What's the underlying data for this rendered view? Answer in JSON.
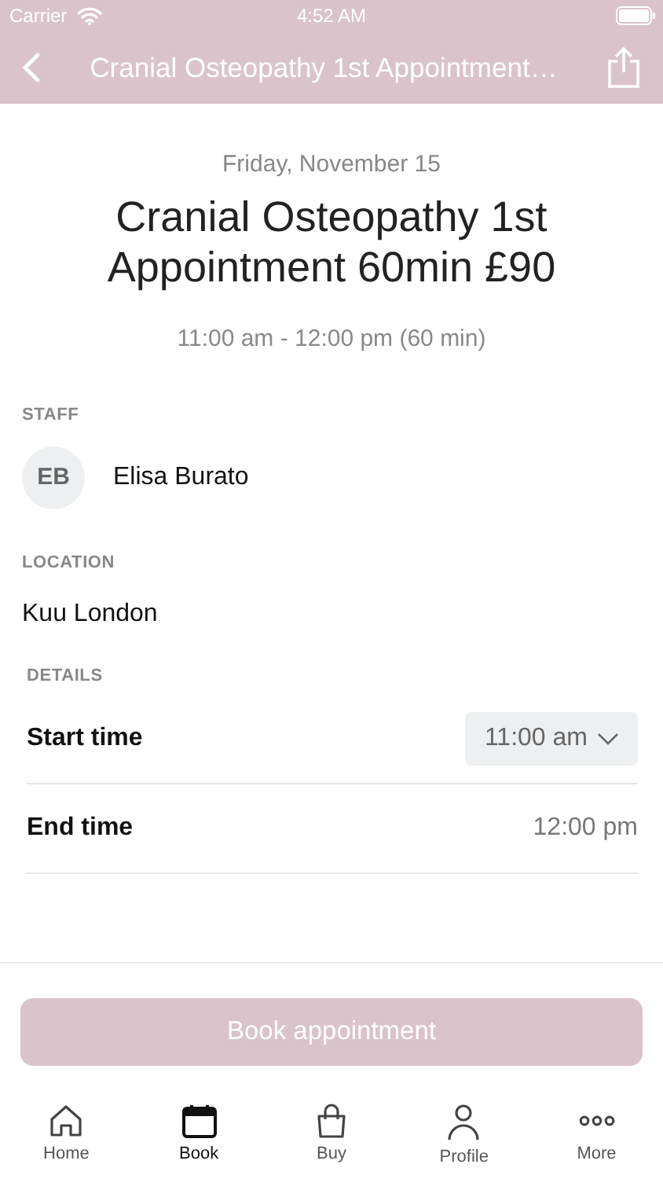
{
  "status_bar": {
    "carrier": "Carrier",
    "time": "4:52 AM"
  },
  "nav": {
    "title": "Cranial Osteopathy 1st Appointment…"
  },
  "header": {
    "date": "Friday, November 15",
    "title": "Cranial Osteopathy 1st Appointment 60min £90",
    "time_range": "11:00 am - 12:00 pm (60 min)"
  },
  "staff": {
    "heading": "STAFF",
    "initials": "EB",
    "name": "Elisa Burato"
  },
  "location": {
    "heading": "LOCATION",
    "name": "Kuu London"
  },
  "details": {
    "heading": "DETAILS",
    "rows": [
      {
        "kind": "dropdown",
        "label": "Start time",
        "value": "11:00 am"
      },
      {
        "kind": "text",
        "label": "End time",
        "value": "12:00 pm"
      }
    ]
  },
  "book_button": {
    "label": "Book appointment",
    "disabled": true
  },
  "tabs": [
    {
      "label": "Home",
      "kind": "home",
      "selected": false
    },
    {
      "label": "Book",
      "kind": "calendar",
      "selected": true
    },
    {
      "label": "Buy",
      "kind": "bag",
      "selected": false
    },
    {
      "label": "Profile",
      "kind": "person",
      "selected": false
    },
    {
      "label": "More",
      "kind": "more",
      "selected": false
    }
  ]
}
